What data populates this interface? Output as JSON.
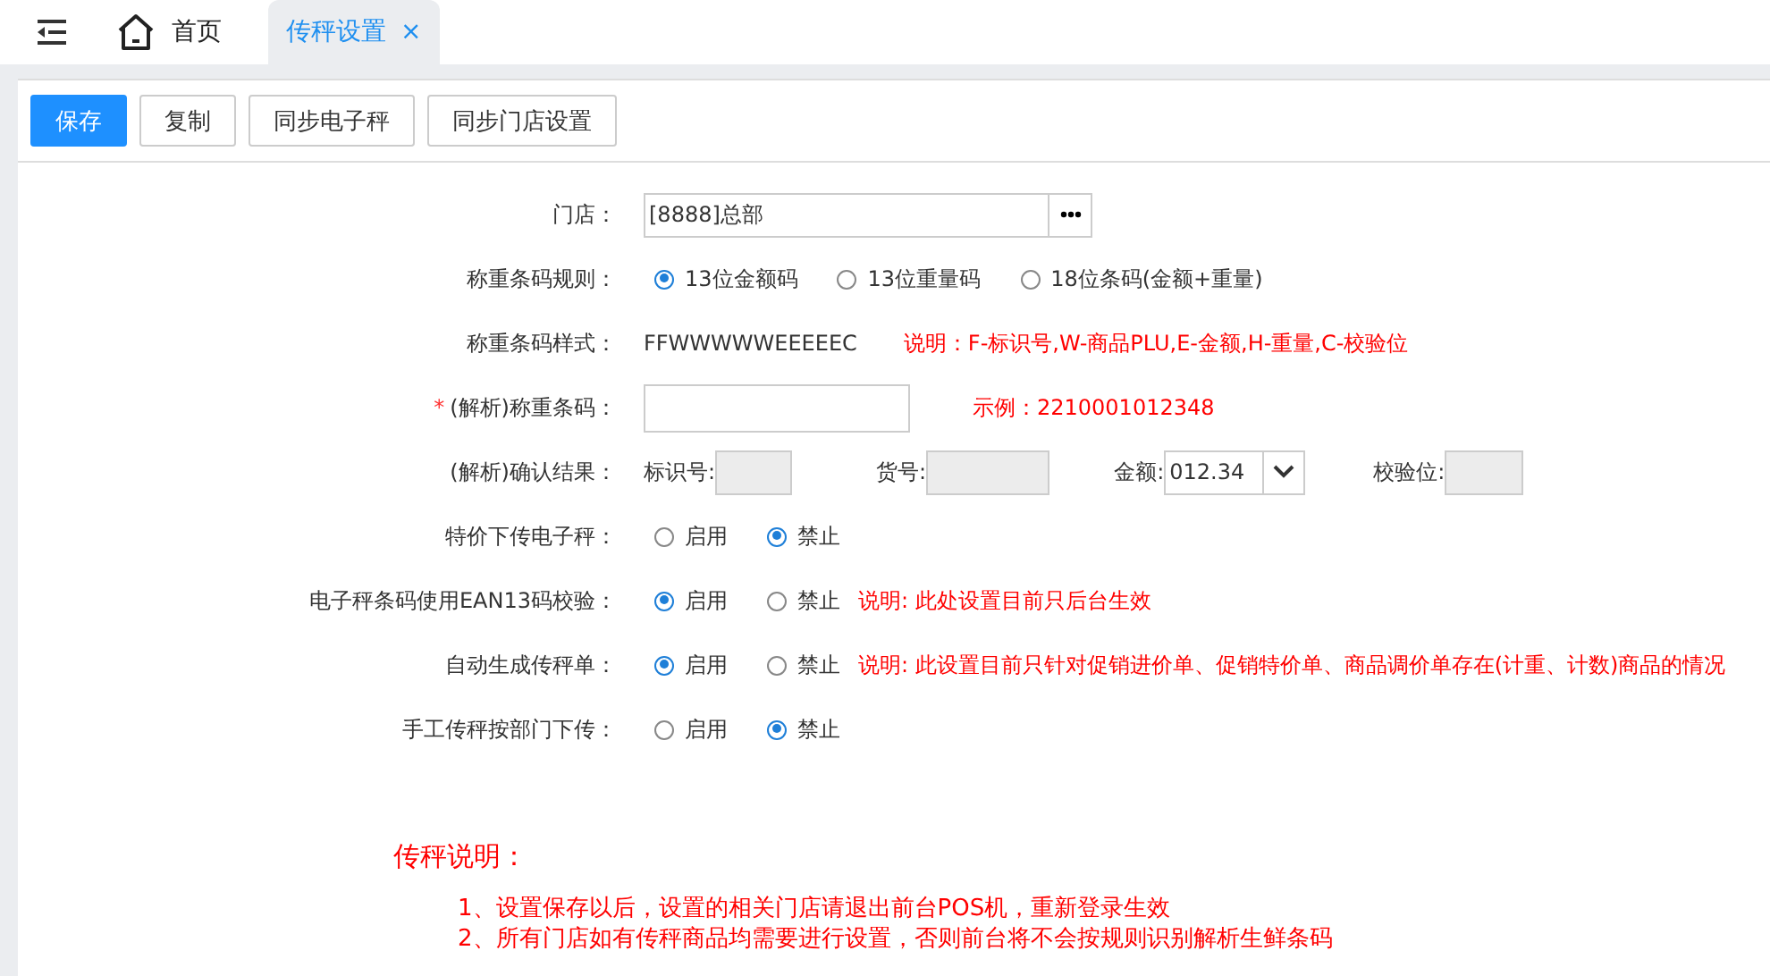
{
  "tabs": [
    {
      "label": "首页",
      "kind": "home",
      "selected": false
    },
    {
      "label": "传秤设置",
      "kind": "page",
      "selected": true,
      "close": "×"
    }
  ],
  "toolbar": [
    {
      "label": "保存",
      "primary": true
    },
    {
      "label": "复制",
      "primary": false
    },
    {
      "label": "同步电子秤",
      "primary": false
    },
    {
      "label": "同步门店设置",
      "primary": false
    }
  ],
  "form": [
    {
      "kind": "lookup",
      "label": "门店：",
      "value": "[8888]总部"
    },
    {
      "kind": "radio",
      "label": "称重条码规则：",
      "options": [
        {
          "label": "13位金额码",
          "selected": true
        },
        {
          "label": "13位重量码",
          "selected": false
        },
        {
          "label": "18位条码(金额+重量)",
          "selected": false
        }
      ]
    },
    {
      "kind": "text",
      "label": "称重条码样式：",
      "value": "FFWWWWWEEEEEC",
      "note": "说明：F-标识号,W-商品PLU,E-金额,H-重量,C-校验位"
    },
    {
      "kind": "input",
      "label": "(解析)称重条码：",
      "required_mark": "*",
      "note": "示例：2210001012348"
    },
    {
      "kind": "parse",
      "label": "(解析)确认结果：",
      "fields": [
        {
          "label": "标识号:",
          "kind": "box"
        },
        {
          "label": "货号:",
          "kind": "box"
        },
        {
          "label": "金额:",
          "kind": "select",
          "value": "012.34"
        },
        {
          "label": "校验位:",
          "kind": "box"
        }
      ]
    },
    {
      "kind": "radio",
      "label": "特价下传电子秤：",
      "options": [
        {
          "label": "启用",
          "selected": false
        },
        {
          "label": "禁止",
          "selected": true
        }
      ]
    },
    {
      "kind": "radio",
      "label": "电子秤条码使用EAN13码校验：",
      "options": [
        {
          "label": "启用",
          "selected": true
        },
        {
          "label": "禁止",
          "selected": false
        }
      ],
      "note": "说明: 此处设置目前只后台生效"
    },
    {
      "kind": "radio",
      "label": "自动生成传秤单：",
      "options": [
        {
          "label": "启用",
          "selected": true
        },
        {
          "label": "禁止",
          "selected": false
        }
      ],
      "note": "说明: 此设置目前只针对促销进价单、促销特价单、商品调价单存在(计重、计数)商品的情况"
    },
    {
      "kind": "radio",
      "label": "手工传秤按部门下传：",
      "options": [
        {
          "label": "启用",
          "selected": false
        },
        {
          "label": "禁止",
          "selected": true
        }
      ]
    }
  ],
  "notes": {
    "title": "传秤说明：",
    "lines": [
      "1、设置保存以后，设置的相关门店请退出前台POS机，重新登录生效",
      "2、所有门店如有传秤商品均需要进行设置，否则前台将不会按规则识别解析生鲜条码"
    ]
  }
}
